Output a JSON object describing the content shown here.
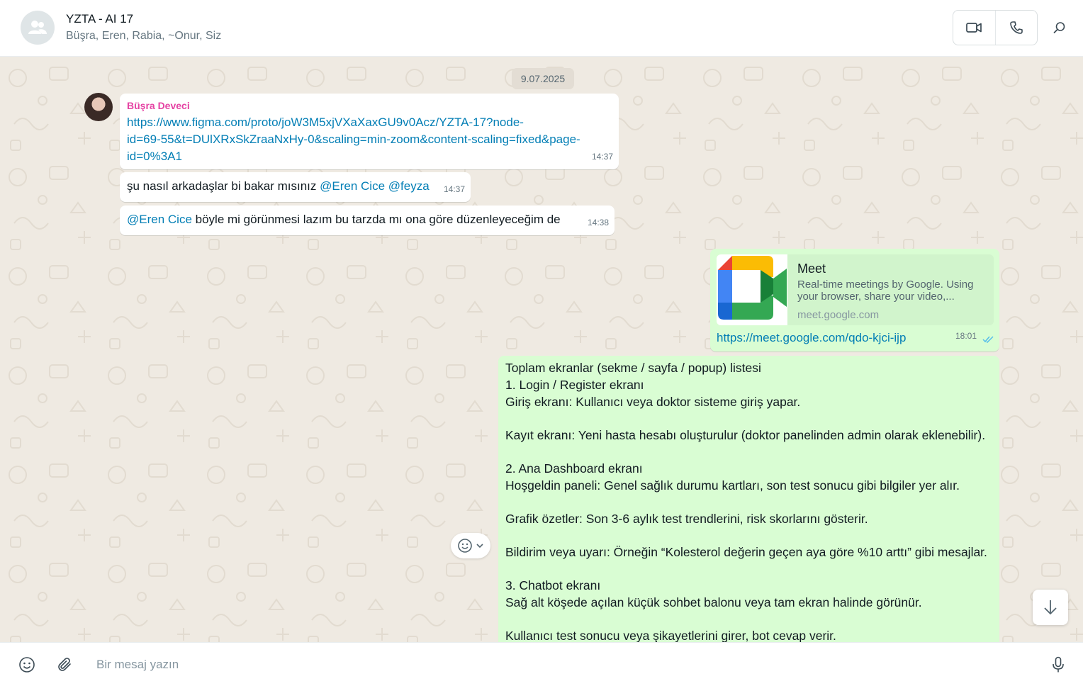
{
  "header": {
    "title": "YZTA - AI 17",
    "members": "Büşra, Eren, Rabia, ~Onur, Siz"
  },
  "chat": {
    "date": "9.07.2025",
    "messages": [
      {
        "sender": "Büşra Deveci",
        "link_line1": "https://www.figma.com/proto/joW3M5xjVXaXaxGU9v0Acz/YZTA-17?node-",
        "link_line2": "id=69-55&t=DUlXRxSkZraaNxHy-0&scaling=min-zoom&content-scaling=fixed&page-",
        "link_line3": "id=0%3A1",
        "time": "14:37"
      },
      {
        "text": "şu nasıl arkadaşlar bi bakar mısınız",
        "mention1": "@Eren Cice",
        "mention2": "@feyza",
        "time": "14:37"
      },
      {
        "mention": "@Eren Cice",
        "text": "böyle mi görünmesi lazım bu tarzda mı ona göre düzenleyeceğim de",
        "time": "14:38"
      },
      {
        "preview_title": "Meet",
        "preview_desc": "Real-time meetings by Google. Using your browser, share your video,...",
        "preview_domain": "meet.google.com",
        "link": "https://meet.google.com/qdo-kjci-ijp",
        "time": "18:01"
      },
      {
        "lines": [
          "Toplam ekranlar (sekme / sayfa / popup) listesi",
          "1. Login / Register ekranı",
          "Giriş ekranı: Kullanıcı veya doktor sisteme giriş yapar.",
          "",
          "Kayıt ekranı: Yeni hasta hesabı oluşturulur (doktor panelinden admin olarak eklenebilir).",
          "",
          "2. Ana Dashboard ekranı",
          "Hoşgeldin paneli: Genel sağlık durumu kartları, son test sonucu gibi bilgiler yer alır.",
          "",
          "Grafik özetler: Son 3-6 aylık test trendlerini, risk skorlarını gösterir.",
          "",
          "Bildirim veya uyarı: Örneğin “Kolesterol değerin geçen aya göre %10 arttı” gibi mesajlar.",
          "",
          "3. Chatbot ekranı",
          "Sağ alt köşede açılan küçük sohbet balonu veya tam ekran halinde görünür.",
          "",
          "Kullanıcı test sonucu veya şikayetlerini girer, bot cevap verir."
        ]
      }
    ]
  },
  "composer": {
    "placeholder": "Bir mesaj yazın"
  },
  "icons": {
    "group_avatar": "group-icon",
    "video": "video-camera-icon",
    "voice": "phone-icon",
    "search": "search-icon",
    "emoji": "emoji-icon",
    "attach": "paperclip-icon",
    "mic": "microphone-icon",
    "scroll": "arrow-down-icon",
    "read": "double-check-icon"
  },
  "colors": {
    "incoming": "#ffffff",
    "outgoing": "#d9fdd3",
    "link": "#027eb5",
    "sender_name": "#e542a3",
    "wallpaper": "#efeae2"
  }
}
